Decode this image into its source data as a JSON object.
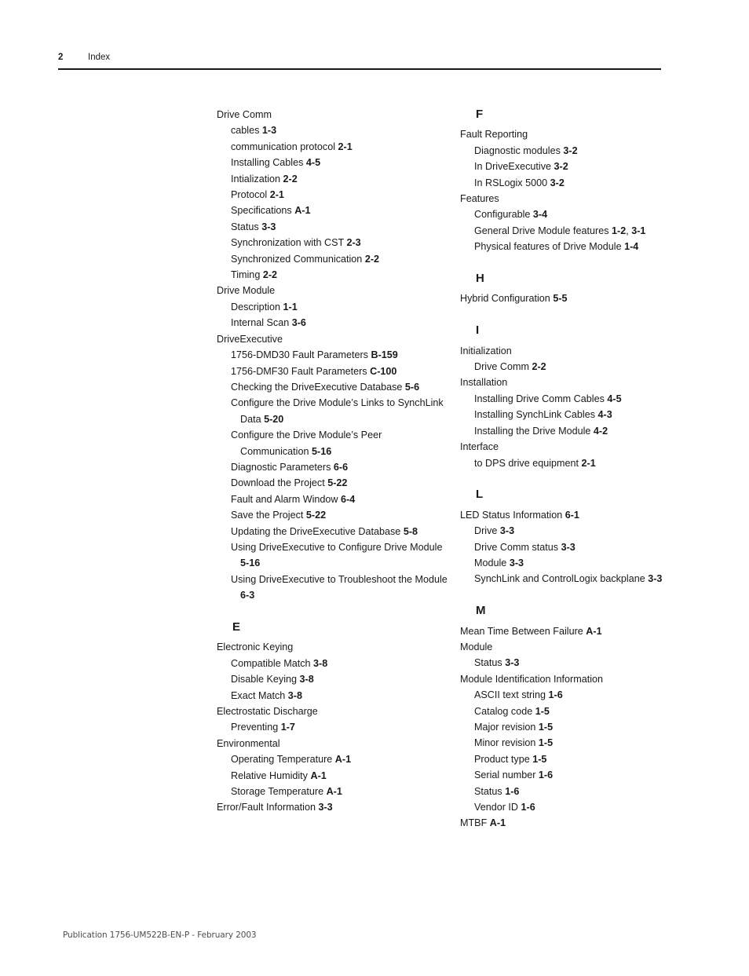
{
  "header": {
    "folio": "2",
    "title": "Index"
  },
  "footer": {
    "publication": "Publication 1756-UM522B-EN-P - February 2003"
  },
  "columns": [
    {
      "name": "left-column",
      "blocks": [
        {
          "type": "entries",
          "entries": [
            {
              "level": 0,
              "text": "Drive Comm",
              "pages": []
            },
            {
              "level": 1,
              "text": "cables",
              "pages": [
                "1-3"
              ]
            },
            {
              "level": 1,
              "text": "communication protocol",
              "pages": [
                "2-1"
              ]
            },
            {
              "level": 1,
              "text": "Installing Cables",
              "pages": [
                "4-5"
              ]
            },
            {
              "level": 1,
              "text": "Intialization",
              "pages": [
                "2-2"
              ]
            },
            {
              "level": 1,
              "text": "Protocol",
              "pages": [
                "2-1"
              ]
            },
            {
              "level": 1,
              "text": "Specifications",
              "pages": [
                "A-1"
              ]
            },
            {
              "level": 1,
              "text": "Status",
              "pages": [
                "3-3"
              ]
            },
            {
              "level": 1,
              "text": "Synchronization with CST",
              "pages": [
                "2-3"
              ]
            },
            {
              "level": 1,
              "text": "Synchronized Communication",
              "pages": [
                "2-2"
              ]
            },
            {
              "level": 1,
              "text": "Timing",
              "pages": [
                "2-2"
              ]
            },
            {
              "level": 0,
              "text": "Drive Module",
              "pages": []
            },
            {
              "level": 1,
              "text": "Description",
              "pages": [
                "1-1"
              ]
            },
            {
              "level": 1,
              "text": "Internal Scan",
              "pages": [
                "3-6"
              ]
            },
            {
              "level": 0,
              "text": "DriveExecutive",
              "pages": []
            },
            {
              "level": 1,
              "text": "1756-DMD30 Fault Parameters",
              "pages": [
                "B-159"
              ]
            },
            {
              "level": 1,
              "text": "1756-DMF30 Fault Parameters",
              "pages": [
                "C-100"
              ]
            },
            {
              "level": 1,
              "text": "Checking the DriveExecutive Database",
              "pages": [
                "5-6"
              ]
            },
            {
              "level": 1,
              "wrap": true,
              "text": "Configure the Drive Module’s Links to SynchLink Data",
              "pages": [
                "5-20"
              ]
            },
            {
              "level": 1,
              "wrap": true,
              "text": "Configure the Drive Module’s Peer Communication",
              "pages": [
                "5-16"
              ]
            },
            {
              "level": 1,
              "text": "Diagnostic Parameters",
              "pages": [
                "6-6"
              ]
            },
            {
              "level": 1,
              "text": "Download the Project",
              "pages": [
                "5-22"
              ]
            },
            {
              "level": 1,
              "text": "Fault and Alarm Window",
              "pages": [
                "6-4"
              ]
            },
            {
              "level": 1,
              "text": "Save the Project",
              "pages": [
                "5-22"
              ]
            },
            {
              "level": 1,
              "text": "Updating the DriveExecutive Database",
              "pages": [
                "5-8"
              ]
            },
            {
              "level": 1,
              "wrap": true,
              "text": "Using DriveExecutive to Configure Drive Module",
              "pages": [
                "5-16"
              ]
            },
            {
              "level": 1,
              "wrap": true,
              "text": "Using DriveExecutive to Troubleshoot the Module",
              "pages": [
                "6-3"
              ]
            }
          ]
        },
        {
          "type": "letter",
          "letter": "E"
        },
        {
          "type": "entries",
          "entries": [
            {
              "level": 0,
              "text": "Electronic Keying",
              "pages": []
            },
            {
              "level": 1,
              "text": "Compatible Match",
              "pages": [
                "3-8"
              ]
            },
            {
              "level": 1,
              "text": "Disable Keying",
              "pages": [
                "3-8"
              ]
            },
            {
              "level": 1,
              "text": "Exact Match",
              "pages": [
                "3-8"
              ]
            },
            {
              "level": 0,
              "text": "Electrostatic Discharge",
              "pages": []
            },
            {
              "level": 1,
              "text": "Preventing",
              "pages": [
                "1-7"
              ]
            },
            {
              "level": 0,
              "text": "Environmental",
              "pages": []
            },
            {
              "level": 1,
              "text": "Operating Temperature",
              "pages": [
                "A-1"
              ]
            },
            {
              "level": 1,
              "text": "Relative Humidity",
              "pages": [
                "A-1"
              ]
            },
            {
              "level": 1,
              "text": "Storage Temperature",
              "pages": [
                "A-1"
              ]
            },
            {
              "level": 0,
              "text": "Error/Fault Information",
              "pages": [
                "3-3"
              ]
            }
          ]
        }
      ]
    },
    {
      "name": "right-column",
      "blocks": [
        {
          "type": "letter",
          "letter": "F",
          "first": true
        },
        {
          "type": "entries",
          "entries": [
            {
              "level": 0,
              "text": "Fault Reporting",
              "pages": []
            },
            {
              "level": 1,
              "text": "Diagnostic modules",
              "pages": [
                "3-2"
              ]
            },
            {
              "level": 1,
              "text": "In DriveExecutive",
              "pages": [
                "3-2"
              ]
            },
            {
              "level": 1,
              "text": "In RSLogix 5000",
              "pages": [
                "3-2"
              ]
            },
            {
              "level": 0,
              "text": "Features",
              "pages": []
            },
            {
              "level": 1,
              "text": "Configurable",
              "pages": [
                "3-4"
              ]
            },
            {
              "level": 1,
              "text": "General Drive Module features",
              "pages": [
                "1-2",
                "3-1"
              ]
            },
            {
              "level": 1,
              "text": "Physical features of Drive Module",
              "pages": [
                "1-4"
              ]
            }
          ]
        },
        {
          "type": "letter",
          "letter": "H"
        },
        {
          "type": "entries",
          "entries": [
            {
              "level": 0,
              "text": "Hybrid Configuration",
              "pages": [
                "5-5"
              ]
            }
          ]
        },
        {
          "type": "letter",
          "letter": "I"
        },
        {
          "type": "entries",
          "entries": [
            {
              "level": 0,
              "text": "Initialization",
              "pages": []
            },
            {
              "level": 1,
              "text": "Drive Comm",
              "pages": [
                "2-2"
              ]
            },
            {
              "level": 0,
              "text": "Installation",
              "pages": []
            },
            {
              "level": 1,
              "text": "Installing Drive Comm Cables",
              "pages": [
                "4-5"
              ]
            },
            {
              "level": 1,
              "text": "Installing SynchLink Cables",
              "pages": [
                "4-3"
              ]
            },
            {
              "level": 1,
              "text": "Installing the Drive Module",
              "pages": [
                "4-2"
              ]
            },
            {
              "level": 0,
              "text": "Interface",
              "pages": []
            },
            {
              "level": 1,
              "text": "to DPS drive equipment",
              "pages": [
                "2-1"
              ]
            }
          ]
        },
        {
          "type": "letter",
          "letter": "L"
        },
        {
          "type": "entries",
          "entries": [
            {
              "level": 0,
              "text": "LED Status Information",
              "pages": [
                "6-1"
              ]
            },
            {
              "level": 1,
              "text": "Drive",
              "pages": [
                "3-3"
              ]
            },
            {
              "level": 1,
              "text": "Drive Comm status",
              "pages": [
                "3-3"
              ]
            },
            {
              "level": 1,
              "text": "Module",
              "pages": [
                "3-3"
              ]
            },
            {
              "level": 1,
              "text": "SynchLink and ControlLogix backplane",
              "pages": [
                "3-3"
              ]
            }
          ]
        },
        {
          "type": "letter",
          "letter": "M"
        },
        {
          "type": "entries",
          "entries": [
            {
              "level": 0,
              "text": "Mean Time Between Failure",
              "pages": [
                "A-1"
              ]
            },
            {
              "level": 0,
              "text": "Module",
              "pages": []
            },
            {
              "level": 1,
              "text": "Status",
              "pages": [
                "3-3"
              ]
            },
            {
              "level": 0,
              "text": "Module Identification Information",
              "pages": []
            },
            {
              "level": 1,
              "text": "ASCII text string",
              "pages": [
                "1-6"
              ]
            },
            {
              "level": 1,
              "text": "Catalog code",
              "pages": [
                "1-5"
              ]
            },
            {
              "level": 1,
              "text": "Major revision",
              "pages": [
                "1-5"
              ]
            },
            {
              "level": 1,
              "text": "Minor revision",
              "pages": [
                "1-5"
              ]
            },
            {
              "level": 1,
              "text": "Product type",
              "pages": [
                "1-5"
              ]
            },
            {
              "level": 1,
              "text": "Serial number",
              "pages": [
                "1-6"
              ]
            },
            {
              "level": 1,
              "text": "Status",
              "pages": [
                "1-6"
              ]
            },
            {
              "level": 1,
              "text": "Vendor ID",
              "pages": [
                "1-6"
              ]
            },
            {
              "level": 0,
              "text": "MTBF",
              "pages": [
                "A-1"
              ]
            }
          ]
        }
      ]
    }
  ]
}
